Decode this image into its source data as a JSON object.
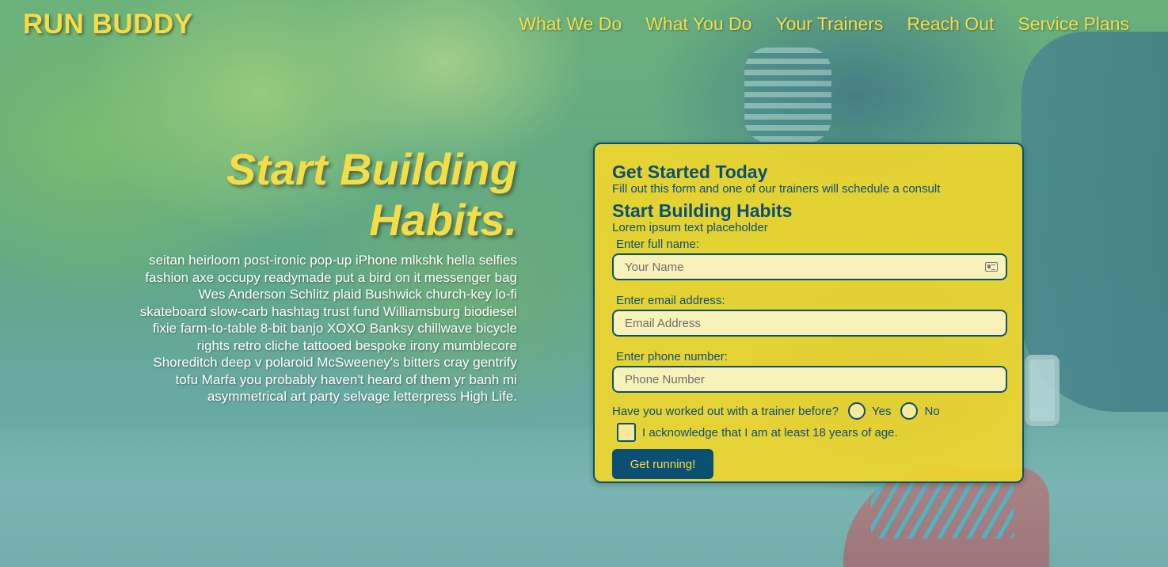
{
  "brand": {
    "logo": "RUN BUDDY"
  },
  "nav": {
    "items": [
      {
        "label": "What We Do"
      },
      {
        "label": "What You Do"
      },
      {
        "label": "Your Trainers"
      },
      {
        "label": "Reach Out"
      },
      {
        "label": "Service Plans"
      }
    ]
  },
  "hero": {
    "title": "Start Building Habits.",
    "body": "seitan heirloom post-ironic pop-up iPhone mlkshk hella selfies fashion axe occupy readymade put a bird on it messenger bag Wes Anderson Schlitz plaid Bushwick church-key lo-fi skateboard slow-carb hashtag trust fund Williamsburg biodiesel fixie farm-to-table 8-bit banjo XOXO Banksy chillwave bicycle rights retro cliche tattooed bespoke irony mumblecore Shoreditch deep v polaroid McSweeney's bitters cray gentrify tofu Marfa you probably haven't heard of them yr banh mi asymmetrical art party selvage letterpress High Life."
  },
  "form": {
    "heading": "Get Started Today",
    "subheading": "Fill out this form and one of our trainers will schedule a consult",
    "heading2": "Start Building Habits",
    "subheading2": "Lorem ipsum text placeholder",
    "name": {
      "label": "Enter full name:",
      "placeholder": "Your Name",
      "value": ""
    },
    "email": {
      "label": "Enter email address:",
      "placeholder": "Email Address",
      "value": ""
    },
    "phone": {
      "label": "Enter phone number:",
      "placeholder": "Phone Number",
      "value": ""
    },
    "trainer_question": "Have you worked out with a trainer before?",
    "yes_label": "Yes",
    "no_label": "No",
    "acknowledge": "I acknowledge that I am at least 18 years of age.",
    "submit_label": "Get running!"
  },
  "colors": {
    "brand_yellow": "#f5dd45",
    "brand_navy": "#0b4f72"
  }
}
